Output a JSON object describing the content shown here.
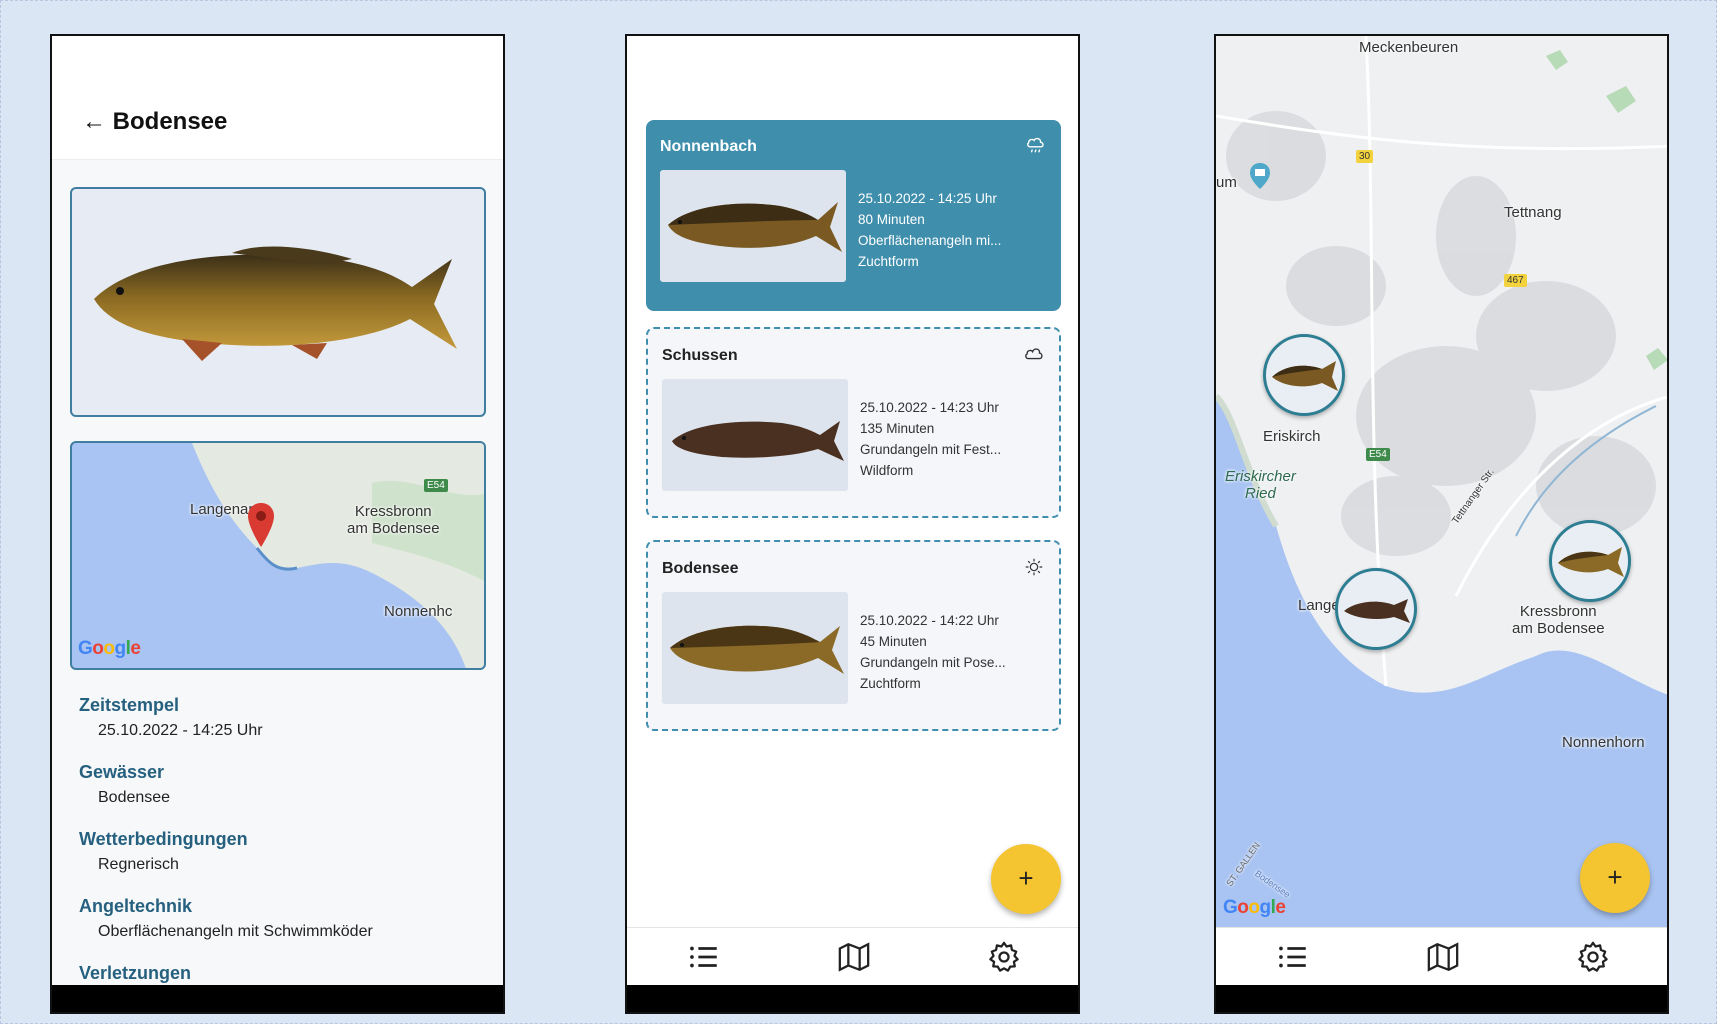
{
  "detail": {
    "title": "Bodensee",
    "map_labels": {
      "langenargen": "Langenar",
      "kressbronn": "Kressbronn\nam Bodensee",
      "nonnenhorn": "Nonnenhc",
      "road": "E54"
    },
    "fields": [
      {
        "label": "Zeitstempel",
        "value": "25.10.2022 - 14:25 Uhr"
      },
      {
        "label": "Gewässer",
        "value": "Bodensee"
      },
      {
        "label": "Wetterbedingungen",
        "value": "Regnerisch"
      },
      {
        "label": "Angeltechnik",
        "value": "Oberflächenangeln mit Schwimmköder"
      },
      {
        "label": "Verletzungen",
        "value": ""
      }
    ]
  },
  "list": {
    "cards": [
      {
        "title": "Nonnenbach",
        "weather_icon": "rain-cloud-icon",
        "timestamp": "25.10.2022 - 14:25 Uhr",
        "duration": "80 Minuten",
        "technique": "Oberflächenangeln mi...",
        "form": "Zuchtform"
      },
      {
        "title": "Schussen",
        "weather_icon": "cloud-icon",
        "timestamp": "25.10.2022 - 14:23 Uhr",
        "duration": "135 Minuten",
        "technique": "Grundangeln mit Fest...",
        "form": "Wildform"
      },
      {
        "title": "Bodensee",
        "weather_icon": "sun-icon",
        "timestamp": "25.10.2022 - 14:22 Uhr",
        "duration": "45 Minuten",
        "technique": "Grundangeln mit Pose...",
        "form": "Zuchtform"
      }
    ],
    "fab_label": "+"
  },
  "map": {
    "labels": {
      "meckenbeuren": "Meckenbeuren",
      "tettnang": "Tettnang",
      "eriskirch": "Eriskirch",
      "ried": "Eriskircher\nRied",
      "langen": "Langer",
      "kressbronn": "Kressbronn\nam Bodensee",
      "nonnenhorn": "Nonnenhorn",
      "road30": "30",
      "road467": "467",
      "roadE54": "E54",
      "um": "um",
      "street": "Tettnanger Str.",
      "stgallen": "ST. GALLEN",
      "bodensee": "Bodensee"
    },
    "fab_label": "+"
  },
  "google": {
    "G": "G",
    "o1": "o",
    "o2": "o",
    "g": "g",
    "l": "l",
    "e": "e"
  },
  "colors": {
    "accent": "#3e8eac",
    "fab": "#f4c431",
    "label": "#26607f",
    "water": "#a9c4f2"
  }
}
